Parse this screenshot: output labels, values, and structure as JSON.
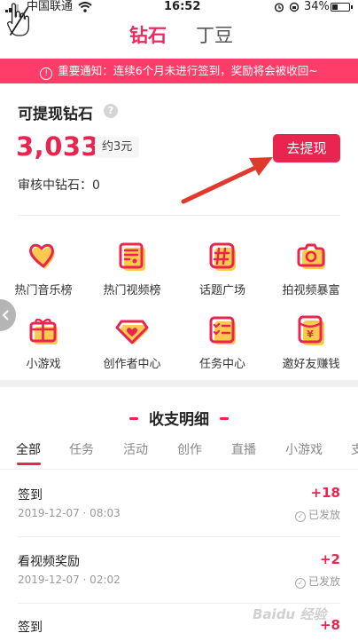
{
  "status_bar": {
    "carrier": "中国联通",
    "time": "16:52",
    "battery": "34%",
    "battery_level": 0.34
  },
  "header": {
    "tabs": [
      {
        "label": "钻石",
        "active": true
      },
      {
        "label": "丁豆",
        "active": false
      }
    ]
  },
  "notice": {
    "icon": "exclamation-icon",
    "text": "重要通知：连续6个月未进行签到，奖励将会被收回~"
  },
  "wallet": {
    "title": "可提现钻石",
    "help_icon": "?",
    "balance": "3,033",
    "approx": "约3元",
    "withdraw_label": "去提现",
    "review_text": "审核中钻石：0"
  },
  "features": [
    {
      "label": "热门音乐榜",
      "icon": "heart-music-icon"
    },
    {
      "label": "热门视频榜",
      "icon": "video-list-icon"
    },
    {
      "label": "话题广场",
      "icon": "hashtag-icon"
    },
    {
      "label": "拍视频暴富",
      "icon": "camera-icon"
    },
    {
      "label": "小游戏",
      "icon": "gift-icon"
    },
    {
      "label": "创作者中心",
      "icon": "diamond-heart-icon"
    },
    {
      "label": "任务中心",
      "icon": "checklist-icon"
    },
    {
      "label": "邀好友赚钱",
      "icon": "red-envelope-icon"
    }
  ],
  "ledger": {
    "title": "收支明细",
    "tabs": [
      "全部",
      "任务",
      "活动",
      "创作",
      "直播",
      "小游戏",
      "支"
    ],
    "entries": [
      {
        "title": "签到",
        "time": "2019-12-07 · 08:03",
        "amount": "+18",
        "status": "已发放"
      },
      {
        "title": "看视频奖励",
        "time": "2019-12-07 · 02:02",
        "amount": "+2",
        "status": "已发放"
      },
      {
        "title": "签到",
        "time": "",
        "amount": "+8",
        "status": ""
      }
    ]
  },
  "colors": {
    "accent": "#e8244f",
    "notice_bg": "#ff3d68",
    "page_bg": "#f0f0f0",
    "icon_shadow": "#ffc94d"
  },
  "watermark": "Baidu 经验"
}
